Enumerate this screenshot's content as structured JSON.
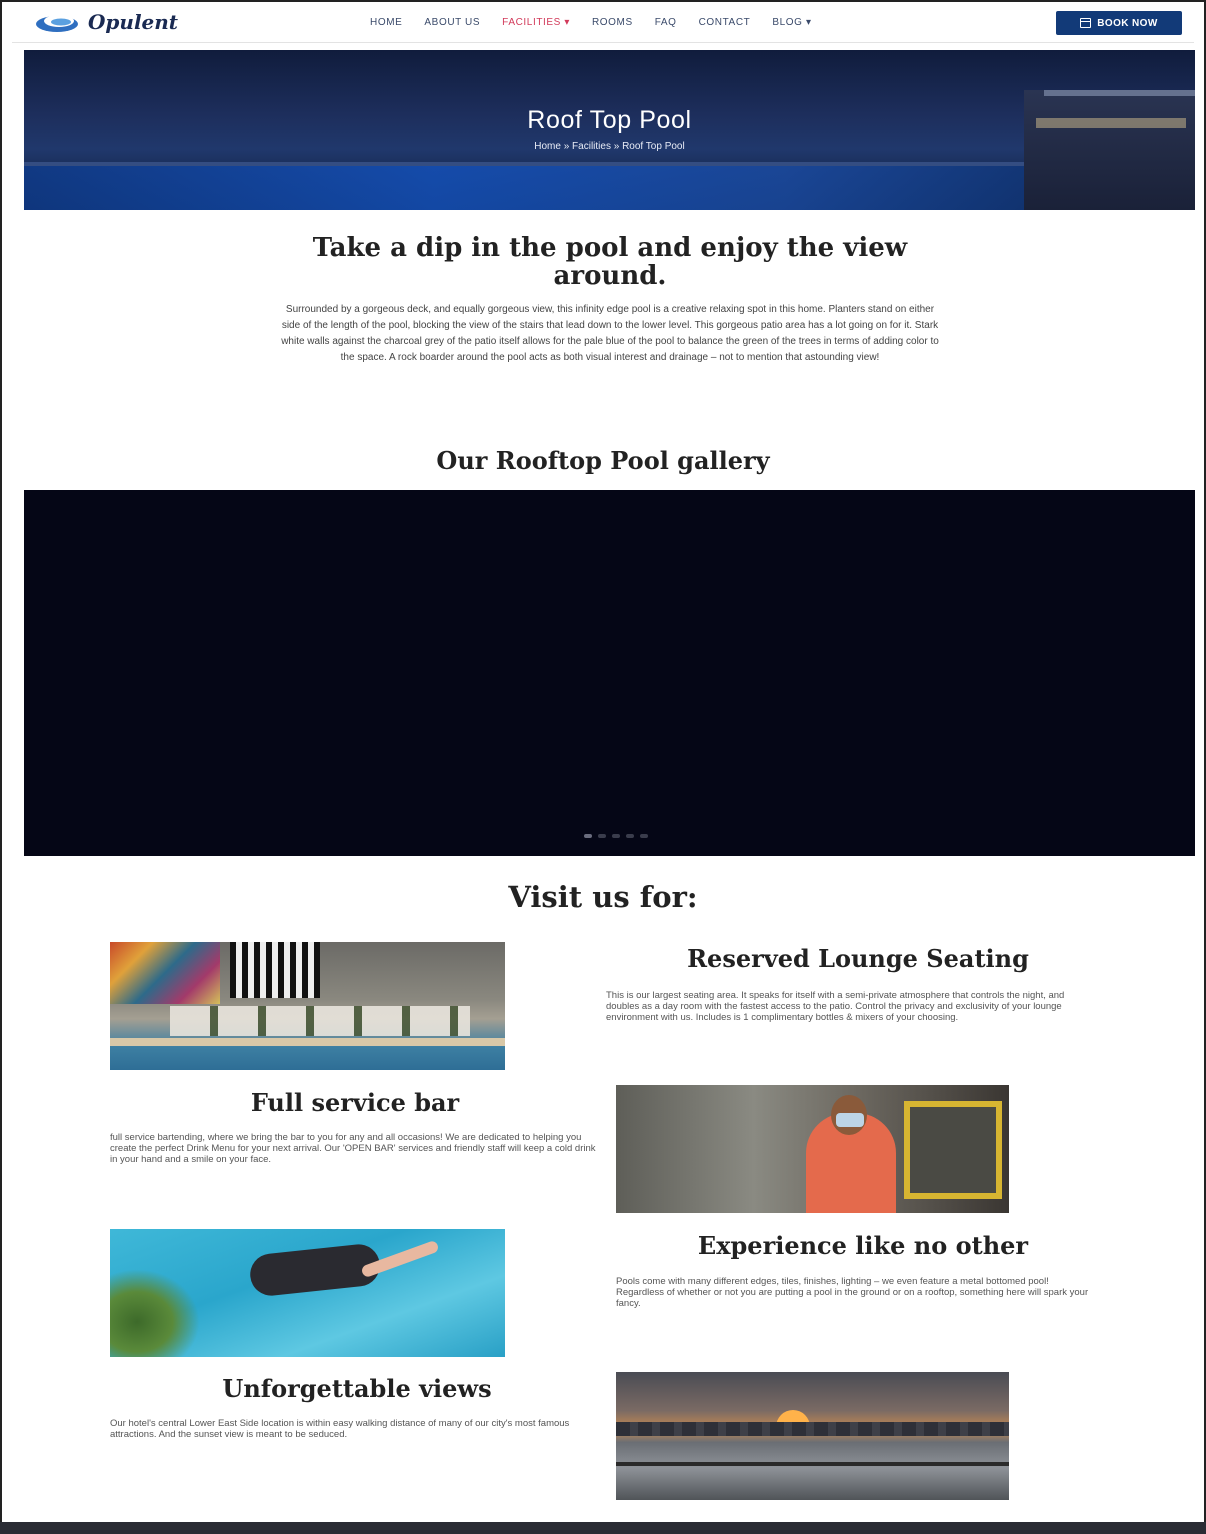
{
  "header": {
    "logo_text": "Opulent",
    "nav": [
      "HOME",
      "ABOUT US",
      "FACILITIES",
      "ROOMS",
      "FAQ",
      "CONTACT",
      "BLOG"
    ],
    "book_label": "BOOK NOW"
  },
  "hero": {
    "title": "Roof Top Pool",
    "breadcrumb": "Home » Facilities » Roof Top Pool"
  },
  "intro": {
    "title": "Take a dip in the pool and enjoy the view around.",
    "text": "Surrounded by a gorgeous deck, and equally gorgeous view, this infinity edge pool is a creative relaxing spot in this home. Planters stand on either side of the length of the pool, blocking the view of the stairs that lead down to the lower level. This gorgeous patio area has a lot going on for it. Stark white walls against the charcoal grey of the patio itself allows for the pale blue of the pool to balance the green of the trees in terms of adding color to the space. A rock boarder around the pool acts as both visual interest and drainage – not to mention that astounding view!"
  },
  "gallery": {
    "title": "Our Rooftop Pool gallery",
    "slide_count": 5,
    "active_slide": 1
  },
  "visit": {
    "title": "Visit us for:",
    "features": [
      {
        "title": "Reserved Lounge Seating",
        "text": "This is our largest seating area. It speaks for itself with a semi-private atmosphere that controls the night, and doubles as a day room with the fastest access to the patio. Control the privacy and exclusivity of your lounge environment with us. Includes is 1 complimentary bottles & mixers of your choosing."
      },
      {
        "title": "Full service bar",
        "text": "full service bartending, where we bring the bar to you for any and all occasions! We are dedicated to helping you create the perfect Drink Menu for your next arrival. Our 'OPEN BAR' services and friendly staff will keep a cold drink in your hand and a smile on your face."
      },
      {
        "title": "Experience like no other",
        "text": "Pools come with many different edges, tiles, finishes, lighting – we even feature a metal bottomed pool! Regardless of whether or not you are putting a pool in the ground or on a rooftop, something here will spark your fancy."
      },
      {
        "title": "Unforgettable views",
        "text": "Our hotel's central Lower East Side location is within easy walking distance of many of our city's most famous attractions. And the sunset view is meant to be seduced."
      }
    ]
  },
  "colors": {
    "accent": "#d23a5a",
    "brand": "#123a78"
  }
}
